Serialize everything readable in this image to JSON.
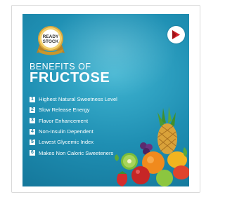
{
  "badge": {
    "line1": "READY",
    "line2": "STOCK"
  },
  "title": {
    "line1": "BENEFITS OF",
    "line2": "FRUCTOSE"
  },
  "benefits": [
    {
      "num": "1",
      "text": "Highest Natural Sweetness Level"
    },
    {
      "num": "2",
      "text": "Slow Release Energy"
    },
    {
      "num": "3",
      "text": "Flavor Enhancement"
    },
    {
      "num": "4",
      "text": "Non-Insulin Dependent"
    },
    {
      "num": "5",
      "text": "Lowest Glycemic Index"
    },
    {
      "num": "6",
      "text": "Makes Non Caloric Sweeteners"
    }
  ],
  "colors": {
    "card": "#1f8fb3",
    "logo_red": "#d6232a",
    "badge_gold": "#c8962c"
  },
  "icons": {
    "badge": "ready-stock-seal",
    "logo": "brand-logo-icon",
    "image": "fruits-image"
  }
}
